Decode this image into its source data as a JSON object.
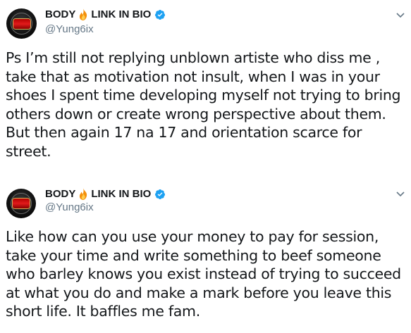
{
  "tweets": [
    {
      "display_name_1": "BODY",
      "display_name_2": "LINK IN BIO",
      "handle": "@Yung6ix",
      "text": "Ps I’m still not replying unblown artiste who diss  me , take that as motivation not insult, when I was in your shoes I spent time developing myself not trying to bring others down or create wrong perspective about them. But then again 17 na 17 and orientation scarce for street."
    },
    {
      "display_name_1": "BODY",
      "display_name_2": "LINK IN BIO",
      "handle": "@Yung6ix",
      "text": "Like how can you use your money to pay for session, take your time and write something to beef someone who barley knows you exist instead of trying to succeed at what you do and make a mark before you leave this short life. It baffles me fam."
    }
  ],
  "icons": {
    "fire": "fire-icon",
    "verified": "verified-badge-icon",
    "more": "chevron-down-icon"
  },
  "colors": {
    "text": "#14171a",
    "secondary": "#657786",
    "verified": "#1da1f2"
  }
}
